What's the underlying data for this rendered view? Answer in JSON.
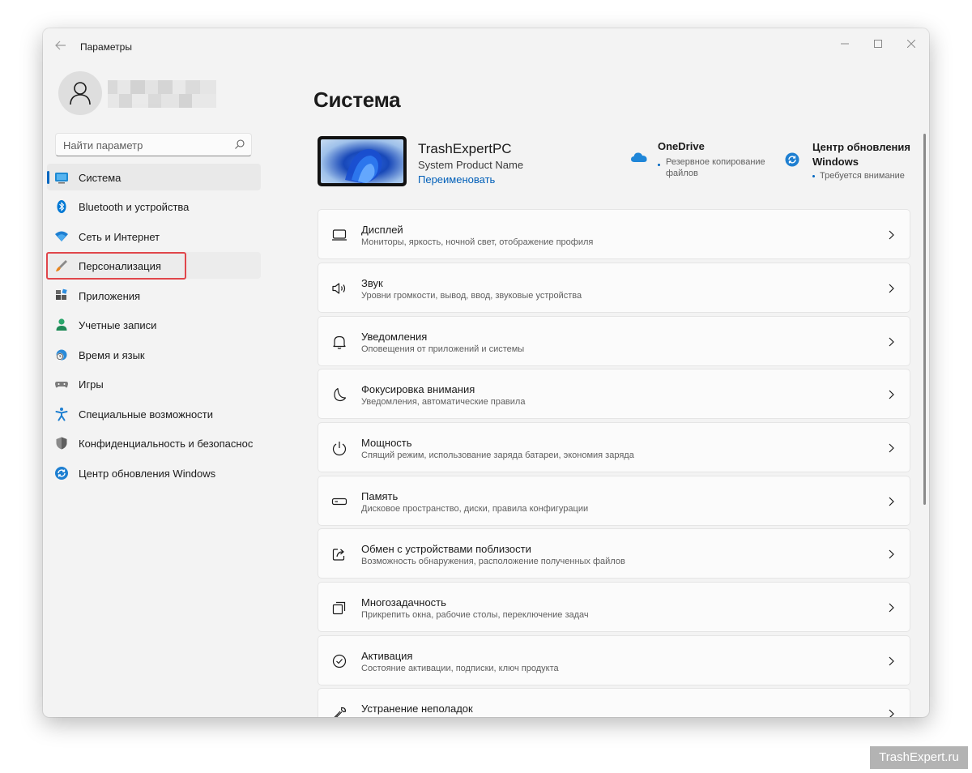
{
  "window": {
    "title": "Параметры"
  },
  "sidebar": {
    "search_placeholder": "Найти параметр",
    "items": [
      {
        "label": "Система",
        "icon": "display-icon",
        "selected": true
      },
      {
        "label": "Bluetooth и устройства",
        "icon": "bluetooth-icon"
      },
      {
        "label": "Сеть и Интернет",
        "icon": "wifi-icon"
      },
      {
        "label": "Персонализация",
        "icon": "brush-icon",
        "highlighted": true
      },
      {
        "label": "Приложения",
        "icon": "apps-icon"
      },
      {
        "label": "Учетные записи",
        "icon": "person-icon"
      },
      {
        "label": "Время и язык",
        "icon": "globe-clock-icon"
      },
      {
        "label": "Игры",
        "icon": "gamepad-icon"
      },
      {
        "label": "Специальные возможности",
        "icon": "accessibility-icon"
      },
      {
        "label": "Конфиденциальность и безопаснос",
        "icon": "shield-icon"
      },
      {
        "label": "Центр обновления Windows",
        "icon": "update-icon"
      }
    ]
  },
  "main": {
    "title": "Система",
    "device": {
      "name": "TrashExpertPC",
      "model": "System Product Name",
      "rename_label": "Переименовать"
    },
    "onedrive": {
      "title": "OneDrive",
      "subtitle": "Резервное копирование файлов"
    },
    "windows_update": {
      "title": "Центр обновления Windows",
      "subtitle": "Требуется внимание"
    },
    "cards": [
      {
        "title": "Дисплей",
        "desc": "Мониторы, яркость, ночной свет, отображение профиля",
        "icon": "monitor-icon"
      },
      {
        "title": "Звук",
        "desc": "Уровни громкости, вывод, ввод, звуковые устройства",
        "icon": "speaker-icon"
      },
      {
        "title": "Уведомления",
        "desc": "Оповещения от приложений и системы",
        "icon": "bell-icon"
      },
      {
        "title": "Фокусировка внимания",
        "desc": "Уведомления, автоматические правила",
        "icon": "moon-icon"
      },
      {
        "title": "Мощность",
        "desc": "Спящий режим, использование заряда батареи, экономия заряда",
        "icon": "power-icon"
      },
      {
        "title": "Память",
        "desc": "Дисковое пространство, диски, правила конфигурации",
        "icon": "storage-icon"
      },
      {
        "title": "Обмен с устройствами поблизости",
        "desc": "Возможность обнаружения, расположение полученных файлов",
        "icon": "share-icon"
      },
      {
        "title": "Многозадачность",
        "desc": "Прикрепить окна, рабочие столы, переключение задач",
        "icon": "multitask-icon"
      },
      {
        "title": "Активация",
        "desc": "Состояние активации, подписки, ключ продукта",
        "icon": "check-circle-icon"
      },
      {
        "title": "Устранение неполадок",
        "desc": "",
        "icon": "wrench-icon"
      }
    ]
  },
  "watermark": "TrashExpert.ru",
  "colors": {
    "accent": "#0067c0",
    "highlight_frame": "#e0464b",
    "window_bg": "#f3f3f3",
    "card_bg": "#fbfbfb"
  }
}
